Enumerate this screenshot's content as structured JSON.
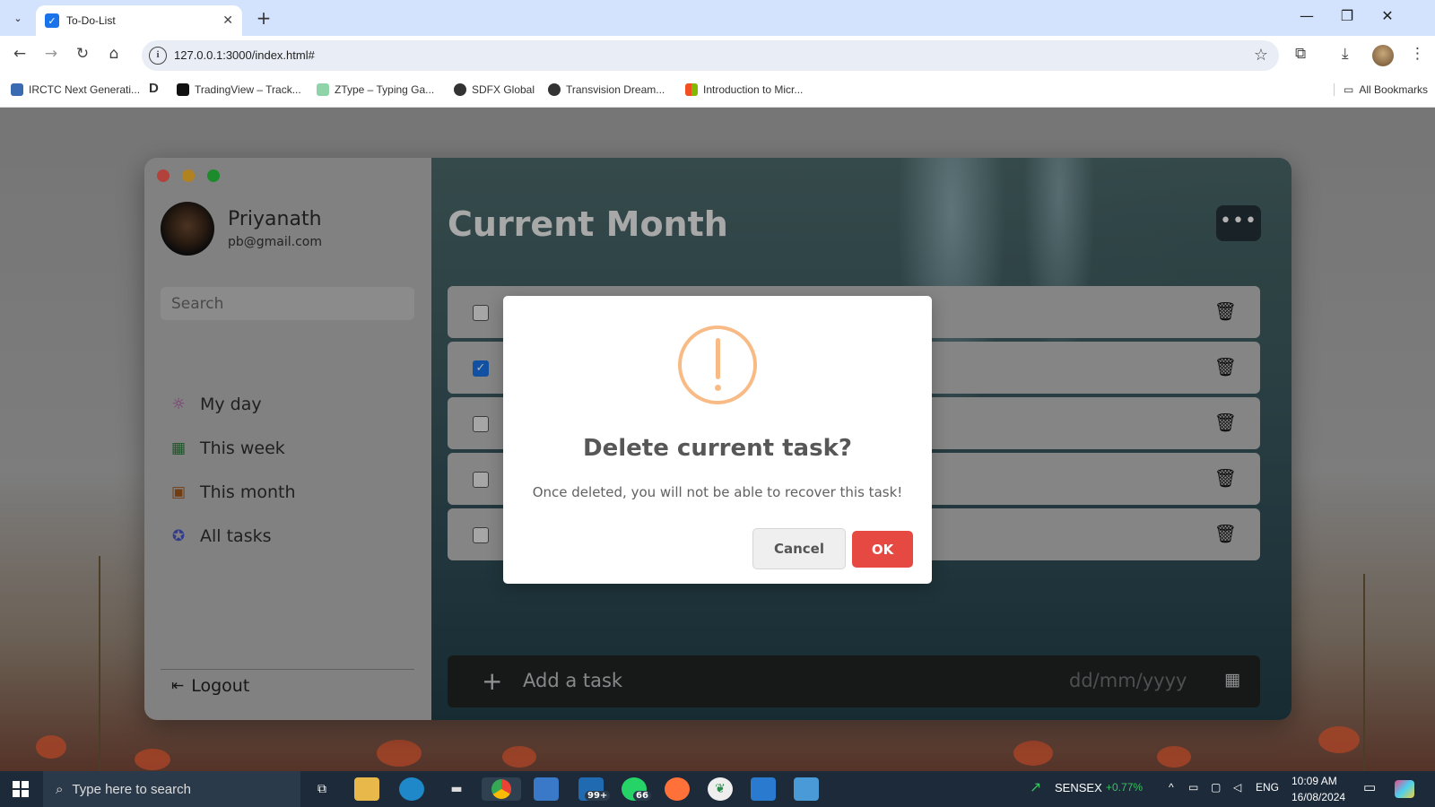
{
  "browser": {
    "tab_title": "To-Do-List",
    "url": "127.0.0.1:3000/index.html#",
    "bookmarks": [
      "IRCTC Next Generati...",
      "TradingView – Track...",
      "ZType – Typing Ga...",
      "SDFX Global",
      "Transvision Dream...",
      "Introduction to Micr..."
    ],
    "all_bookmarks": "All Bookmarks"
  },
  "sidebar": {
    "name": "Priyanath",
    "email": "pb@gmail.com",
    "search_placeholder": "Search",
    "nav": [
      {
        "label": "My day",
        "icon": "sun-icon"
      },
      {
        "label": "This week",
        "icon": "grid-icon"
      },
      {
        "label": "This month",
        "icon": "calendar-icon"
      },
      {
        "label": "All tasks",
        "icon": "star-badge-icon"
      }
    ],
    "logout": "Logout"
  },
  "main": {
    "title": "Current Month",
    "more": "•••",
    "tasks": [
      {
        "checked": false
      },
      {
        "checked": true
      },
      {
        "checked": false
      },
      {
        "checked": false
      },
      {
        "checked": false
      }
    ],
    "add_placeholder": "Add a task",
    "date_placeholder": "dd/mm/yyyy"
  },
  "dialog": {
    "title": "Delete current task?",
    "text": "Once deleted, you will not be able to recover this task!",
    "cancel": "Cancel",
    "ok": "OK"
  },
  "taskbar": {
    "search_placeholder": "Type here to search",
    "sensex_label": "SENSEX",
    "sensex_change": "+0.77%",
    "lang": "ENG",
    "time": "10:09 AM",
    "date": "16/08/2024",
    "badge_mail": "99+",
    "badge_whatsapp": "66"
  },
  "colors": {
    "ok_button": "#e64942",
    "warning": "#f8bb86",
    "checkbox_checked": "#1a73e8"
  }
}
